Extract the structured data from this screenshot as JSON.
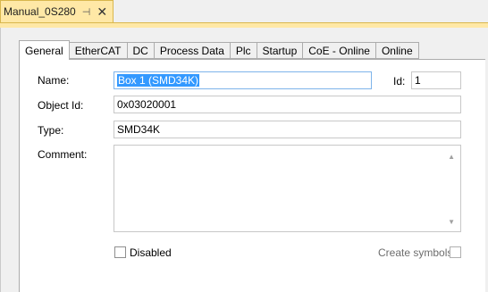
{
  "doc_tab": {
    "title": "Manual_0S280",
    "pin": "⊣",
    "close": "✕"
  },
  "tabs": [
    "General",
    "EtherCAT",
    "DC",
    "Process Data",
    "Plc",
    "Startup",
    "CoE - Online",
    "Online"
  ],
  "active_tab": "General",
  "form": {
    "name_label": "Name:",
    "name_value": "Box 1 (SMD34K)",
    "id_label": "Id:",
    "id_value": "1",
    "object_id_label": "Object Id:",
    "object_id_value": "0x03020001",
    "type_label": "Type:",
    "type_value": "SMD34K",
    "comment_label": "Comment:",
    "comment_value": "",
    "disabled_label": "Disabled",
    "create_symbols_label": "Create symbols"
  }
}
